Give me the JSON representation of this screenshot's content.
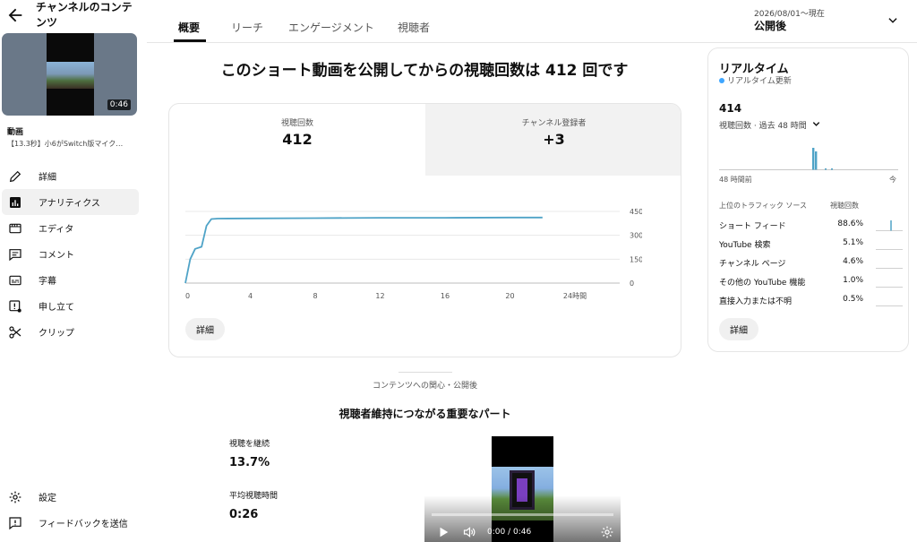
{
  "sidebar": {
    "title": "チャンネルのコンテンツ",
    "thumbnail_duration": "0:46",
    "video_label": "動画",
    "video_title": "【13.3秒】小6がSwitch版マイク…",
    "nav": [
      {
        "label": "詳細",
        "icon": "pencil-icon"
      },
      {
        "label": "アナリティクス",
        "icon": "analytics-icon",
        "active": true
      },
      {
        "label": "エディタ",
        "icon": "editor-icon"
      },
      {
        "label": "コメント",
        "icon": "comment-icon"
      },
      {
        "label": "字幕",
        "icon": "subtitles-icon"
      },
      {
        "label": "申し立て",
        "icon": "claim-icon"
      },
      {
        "label": "クリップ",
        "icon": "scissors-icon"
      }
    ],
    "settings_label": "設定",
    "feedback_label": "フィードバックを送信"
  },
  "tabs": [
    {
      "label": "概要",
      "active": true
    },
    {
      "label": "リーチ"
    },
    {
      "label": "エンゲージメント"
    },
    {
      "label": "視聴者"
    }
  ],
  "date": {
    "range": "2026/08/01～現在",
    "selected": "公開後"
  },
  "headline": "このショート動画を公開してからの視聴回数は 412 回です",
  "metrics": {
    "views_label": "視聴回数",
    "views_value": "412",
    "subs_label": "チャンネル登録者",
    "subs_value": "+3"
  },
  "chart_data": {
    "type": "line",
    "x": [
      0,
      0.3,
      0.6,
      1.0,
      1.3,
      1.6,
      2,
      4,
      8,
      12,
      16,
      20,
      21,
      22
    ],
    "values": [
      0,
      150,
      215,
      228,
      360,
      402,
      405,
      406,
      408,
      410,
      410,
      412,
      412,
      412
    ],
    "xticks": [
      "0",
      "4",
      "8",
      "12",
      "16",
      "20",
      "24時間"
    ],
    "xtick_values": [
      0,
      4,
      8,
      12,
      16,
      20,
      24
    ],
    "yticks": [
      "0",
      "150",
      "300",
      "450"
    ],
    "ytick_values": [
      0,
      150,
      300,
      450
    ],
    "xlim": [
      0,
      24
    ],
    "ylim": [
      0,
      450
    ],
    "grid": true,
    "color": "#4fa3c7"
  },
  "details_label": "詳細",
  "realtime": {
    "title": "リアルタイム",
    "update_label": "リアルタイム更新",
    "value": "414",
    "period": "視聴回数 · 過去 48 時間",
    "x_left": "48 時間前",
    "x_right": "今",
    "bar_color": "#4fa3c7",
    "traffic_header": "上位のトラフィック ソース",
    "traffic_col": "視聴回数",
    "sources": [
      {
        "name": "ショート フィード",
        "pct": "88.6%"
      },
      {
        "name": "YouTube 検索",
        "pct": "5.1%"
      },
      {
        "name": "チャンネル ページ",
        "pct": "4.6%"
      },
      {
        "name": "その他の YouTube 機能",
        "pct": "1.0%"
      },
      {
        "name": "直接入力または不明",
        "pct": "0.5%"
      }
    ],
    "details_label": "詳細"
  },
  "interest_label": "コンテンツへの関心・公開後",
  "key_parts_title": "視聴者維持につながる重要なパート",
  "retention": {
    "keep_label": "視聴を継続",
    "keep_value": "13.7%",
    "avg_label": "平均視聴時間",
    "avg_value": "0:26"
  },
  "player": {
    "time": "0:00 / 0:46"
  }
}
